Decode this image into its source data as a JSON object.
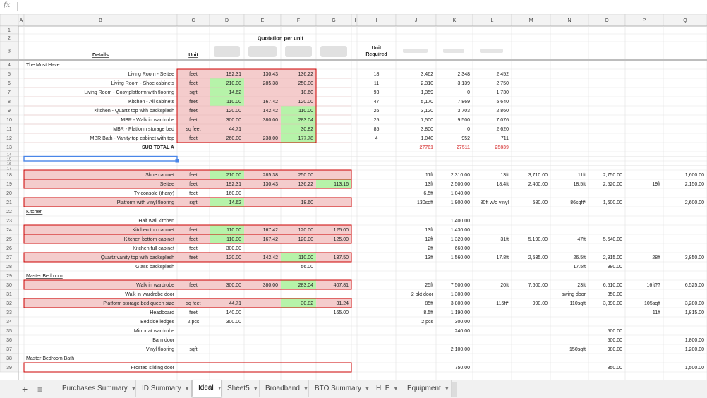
{
  "formula_bar": {
    "fx_label": "fx",
    "value": ""
  },
  "columns": [
    "A",
    "B",
    "C",
    "D",
    "E",
    "F",
    "G",
    "H",
    "I",
    "J",
    "K",
    "L",
    "M",
    "N",
    "O",
    "P",
    "Q"
  ],
  "quote_header": "Quotation per unit",
  "rows": [
    {
      "n": 1,
      "cells": {}
    },
    {
      "n": 2,
      "cells": {}
    },
    {
      "n": 3,
      "cells": {
        "B": "Details",
        "C": "Unit",
        "I": "Unit Required"
      }
    },
    {
      "n": 4,
      "cells": {
        "B": "The Must Have"
      }
    },
    {
      "n": 5,
      "cells": {
        "B": "Living Room - Settee",
        "C": "feet",
        "D": "192.31",
        "E": "130.43",
        "F": "136.22",
        "I": "18",
        "J": "3,462",
        "K": "2,348",
        "L": "2,452"
      }
    },
    {
      "n": 6,
      "cells": {
        "B": "Living Room - Shoe cabinets",
        "C": "feet",
        "D": "210.00",
        "E": "285.38",
        "F": "250.00",
        "I": "11",
        "J": "2,310",
        "K": "3,139",
        "L": "2,750"
      }
    },
    {
      "n": 7,
      "cells": {
        "B": "Living Room - Cosy platform with flooring",
        "C": "sqft",
        "D": "14.62",
        "F": "18.60",
        "I": "93",
        "J": "1,359",
        "K": "0",
        "L": "1,730"
      }
    },
    {
      "n": 8,
      "cells": {
        "B": "Kitchen - All cabinets",
        "C": "feet",
        "D": "110.00",
        "E": "167.42",
        "F": "120.00",
        "I": "47",
        "J": "5,170",
        "K": "7,869",
        "L": "5,640"
      }
    },
    {
      "n": 9,
      "cells": {
        "B": "Kitchen - Quartz top with backsplash",
        "C": "feet",
        "D": "120.00",
        "E": "142.42",
        "F": "110.00",
        "I": "26",
        "J": "3,120",
        "K": "3,703",
        "L": "2,860"
      }
    },
    {
      "n": 10,
      "cells": {
        "B": "MBR - Walk in wardrobe",
        "C": "feet",
        "D": "300.00",
        "E": "380.00",
        "F": "283.04",
        "I": "25",
        "J": "7,500",
        "K": "9,500",
        "L": "7,076"
      }
    },
    {
      "n": 11,
      "cells": {
        "B": "MBR - Platform storage bed",
        "C": "sq feet",
        "D": "44.71",
        "F": "30.82",
        "I": "85",
        "J": "3,800",
        "K": "0",
        "L": "2,620"
      }
    },
    {
      "n": 12,
      "cells": {
        "B": "MBR Bath - Vanity top cabinet with top",
        "C": "feet",
        "D": "260.00",
        "E": "238.00",
        "F": "177.78",
        "I": "4",
        "J": "1,040",
        "K": "952",
        "L": "711"
      }
    },
    {
      "n": 13,
      "cells": {
        "B": "SUB TOTAL A",
        "J": "27761",
        "K": "27511",
        "L": "25839"
      }
    },
    {
      "n": 14,
      "cells": {}
    },
    {
      "n": 15,
      "cells": {}
    },
    {
      "n": 16,
      "cells": {}
    },
    {
      "n": 17,
      "cells": {}
    },
    {
      "n": 18,
      "cells": {
        "B": "Shoe cabinet",
        "C": "feet",
        "D": "210.00",
        "E": "285.38",
        "F": "250.00",
        "J": "11ft",
        "K": "2,310.00",
        "L": "13ft",
        "M": "3,710.00",
        "N": "11ft",
        "O": "2,750.00",
        "Q": "1,600.00"
      }
    },
    {
      "n": 19,
      "cells": {
        "B": "Settee",
        "C": "feet",
        "D": "192.31",
        "E": "130.43",
        "F": "136.22",
        "G": "113.16",
        "J": "13ft",
        "K": "2,500.00",
        "L": "18.4ft",
        "M": "2,400.00",
        "N": "18.5ft",
        "O": "2,520.00",
        "P": "19ft",
        "Q": "2,150.00"
      }
    },
    {
      "n": 20,
      "cells": {
        "B": "Tv console (if any)",
        "C": "feet",
        "D": "160.00",
        "J": "6.5ft",
        "K": "1,040.00"
      }
    },
    {
      "n": 21,
      "cells": {
        "B": "Platform with vinyl flooring",
        "C": "sqft",
        "D": "14.62",
        "F": "18.60",
        "J": "130sqft",
        "K": "1,900.00",
        "L": "80ft w/o vinyl",
        "M": "580.00",
        "N": "86sqft*",
        "O": "1,600.00",
        "Q": "2,600.00"
      }
    },
    {
      "n": 22,
      "cells": {
        "B": "Kitchen"
      }
    },
    {
      "n": 23,
      "cells": {
        "B": "Half wall kitchen",
        "K": "1,400.00"
      }
    },
    {
      "n": 24,
      "cells": {
        "B": "Kitchen top cabinet",
        "C": "feet",
        "D": "110.00",
        "E": "167.42",
        "F": "120.00",
        "G": "125.00",
        "J": "13ft",
        "K": "1,430.00"
      }
    },
    {
      "n": 25,
      "cells": {
        "B": "Kitchen bottom cabinet",
        "C": "feet",
        "D": "110.00",
        "E": "167.42",
        "F": "120.00",
        "G": "125.00",
        "J": "12ft",
        "K": "1,320.00",
        "L": "31ft",
        "M": "5,190.00",
        "N": "47ft",
        "O": "5,640.00"
      }
    },
    {
      "n": 26,
      "cells": {
        "B": "Kitchen full cabinet",
        "C": "feet",
        "D": "300.00",
        "J": "2ft",
        "K": "660.00"
      }
    },
    {
      "n": 27,
      "cells": {
        "B": "Quartz vanity top with backsplash",
        "C": "feet",
        "D": "120.00",
        "E": "142.42",
        "F": "110.00",
        "G": "137.50",
        "J": "13ft",
        "K": "1,560.00",
        "L": "17.8ft",
        "M": "2,535.00",
        "N": "26.5ft",
        "O": "2,915.00",
        "P": "28ft",
        "Q": "3,850.00"
      }
    },
    {
      "n": 28,
      "cells": {
        "B": "Glass backsplash",
        "F": "56.00",
        "N": "17.5ft",
        "O": "980.00"
      }
    },
    {
      "n": 29,
      "cells": {
        "B": "Master Bedroom"
      }
    },
    {
      "n": 30,
      "cells": {
        "B": "Walk in wardrobe",
        "C": "feet",
        "D": "300.00",
        "E": "380.00",
        "F": "283.04",
        "G": "407.81",
        "J": "25ft",
        "K": "7,500.00",
        "L": "20ft",
        "M": "7,600.00",
        "N": "23ft",
        "O": "6,510.00",
        "P": "16ft??",
        "Q": "6,525.00"
      }
    },
    {
      "n": 31,
      "cells": {
        "B": "Walk in wardrobe door",
        "J": "2 pkt door",
        "K": "1,300.00",
        "N": "swing door",
        "O": "350.00"
      }
    },
    {
      "n": 32,
      "cells": {
        "B": "Platform storage bed queen size",
        "C": "sq feet",
        "D": "44.71",
        "F": "30.82",
        "G": "31.24",
        "J": "85ft",
        "K": "3,800.00",
        "L": "115ft*",
        "M": "990.00",
        "N": "110sqft",
        "O": "3,390.00",
        "P": "105sqft",
        "Q": "3,280.00"
      }
    },
    {
      "n": 33,
      "cells": {
        "B": "Headboard",
        "C": "feet",
        "D": "140.00",
        "G": "165.00",
        "J": "8.5ft",
        "K": "1,190.00",
        "P": "11ft",
        "Q": "1,815.00"
      }
    },
    {
      "n": 34,
      "cells": {
        "B": "Bedside ledges",
        "C": "2 pcs",
        "D": "300.00",
        "J": "2 pcs",
        "K": "300.00"
      }
    },
    {
      "n": 35,
      "cells": {
        "B": "Mirror at wardrobe",
        "K": "240.00",
        "O": "500.00"
      }
    },
    {
      "n": 36,
      "cells": {
        "B": "Barn door",
        "O": "500.00",
        "Q": "1,800.00"
      }
    },
    {
      "n": 37,
      "cells": {
        "B": "Vinyl flooring",
        "C": "sqft",
        "K": "2,100.00",
        "N": "150sqft",
        "O": "980.00",
        "Q": "1,200.00"
      }
    },
    {
      "n": 38,
      "cells": {
        "B": "Master Bedroom Bath"
      }
    },
    {
      "n": 39,
      "cells": {
        "B": "Frosted sliding door",
        "K": "750.00",
        "O": "850.00",
        "Q": "1,500.00"
      }
    }
  ],
  "tabbar": {
    "add_label": "+",
    "list_label": "≡"
  },
  "tabs": [
    {
      "label": "Purchases Summary",
      "active": false
    },
    {
      "label": "ID Summary",
      "active": false
    },
    {
      "label": "Ideal",
      "active": true
    },
    {
      "label": "Sheet5",
      "active": false
    },
    {
      "label": "Broadband",
      "active": false
    },
    {
      "label": "BTO Summary",
      "active": false
    },
    {
      "label": "HLE",
      "active": false
    },
    {
      "label": "Equipment",
      "active": false
    }
  ],
  "colors": {
    "pink": "#f4cccc",
    "green": "#b6f3a9",
    "red_text": "#e06666",
    "grid": "#e2e2e2",
    "header_bg": "#f3f3f3",
    "red_border": "#cc0000",
    "selection": "#4a86e8"
  }
}
